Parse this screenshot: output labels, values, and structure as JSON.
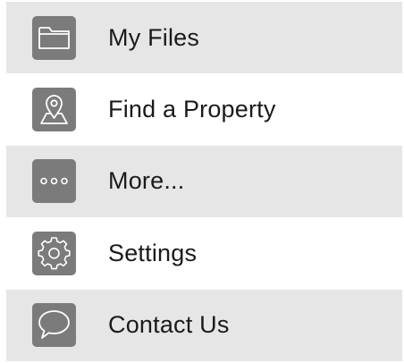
{
  "menu": {
    "items": [
      {
        "label": "My Files",
        "icon": "folder-icon"
      },
      {
        "label": "Find a Property",
        "icon": "map-location-icon"
      },
      {
        "label": "More...",
        "icon": "more-dots-icon"
      },
      {
        "label": "Settings",
        "icon": "gear-icon"
      },
      {
        "label": "Contact Us",
        "icon": "speech-bubble-icon"
      }
    ]
  },
  "colors": {
    "shaded_row": "#e6e6e6",
    "plain_row": "#ffffff",
    "icon_tile": "#7b7b7b",
    "icon_line": "#ffffff",
    "label_text": "#1a1a1a"
  }
}
